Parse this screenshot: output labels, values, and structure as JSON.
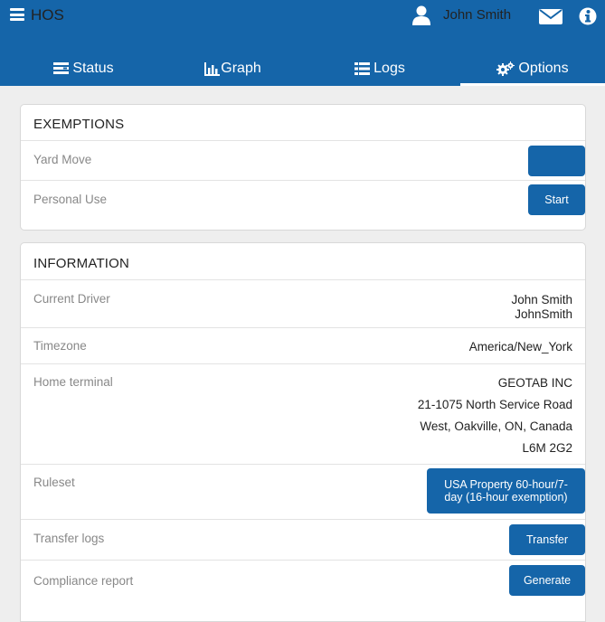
{
  "header": {
    "app_title": "HOS",
    "user_name": "John Smith"
  },
  "tabs": [
    {
      "label": "Status",
      "icon": "status-icon"
    },
    {
      "label": "Graph",
      "icon": "graph-icon"
    },
    {
      "label": "Logs",
      "icon": "list-icon"
    },
    {
      "label": "Options",
      "icon": "gears-icon"
    }
  ],
  "active_tab": "Options",
  "exemptions": {
    "title": "EXEMPTIONS",
    "rows": [
      {
        "label": "Yard Move",
        "button": ""
      },
      {
        "label": "Personal Use",
        "button": "Start"
      }
    ]
  },
  "information": {
    "title": "INFORMATION",
    "current_driver": {
      "label": "Current Driver",
      "name": "John Smith",
      "username": "JohnSmith"
    },
    "timezone": {
      "label": "Timezone",
      "value": "America/New_York"
    },
    "home_terminal": {
      "label": "Home terminal",
      "line1": "GEOTAB INC",
      "line2": "21-1075 North Service Road",
      "line3": "West, Oakville, ON, Canada",
      "line4": "L6M 2G2"
    },
    "ruleset": {
      "label": "Ruleset",
      "button": "USA Property 60-hour/7-day (16-hour exemption)"
    },
    "transfer": {
      "label": "Transfer logs",
      "button": "Transfer"
    },
    "compliance": {
      "label": "Compliance report",
      "button": "Generate"
    }
  },
  "colors": {
    "primary": "#1565a9",
    "background": "#eeeeee"
  }
}
